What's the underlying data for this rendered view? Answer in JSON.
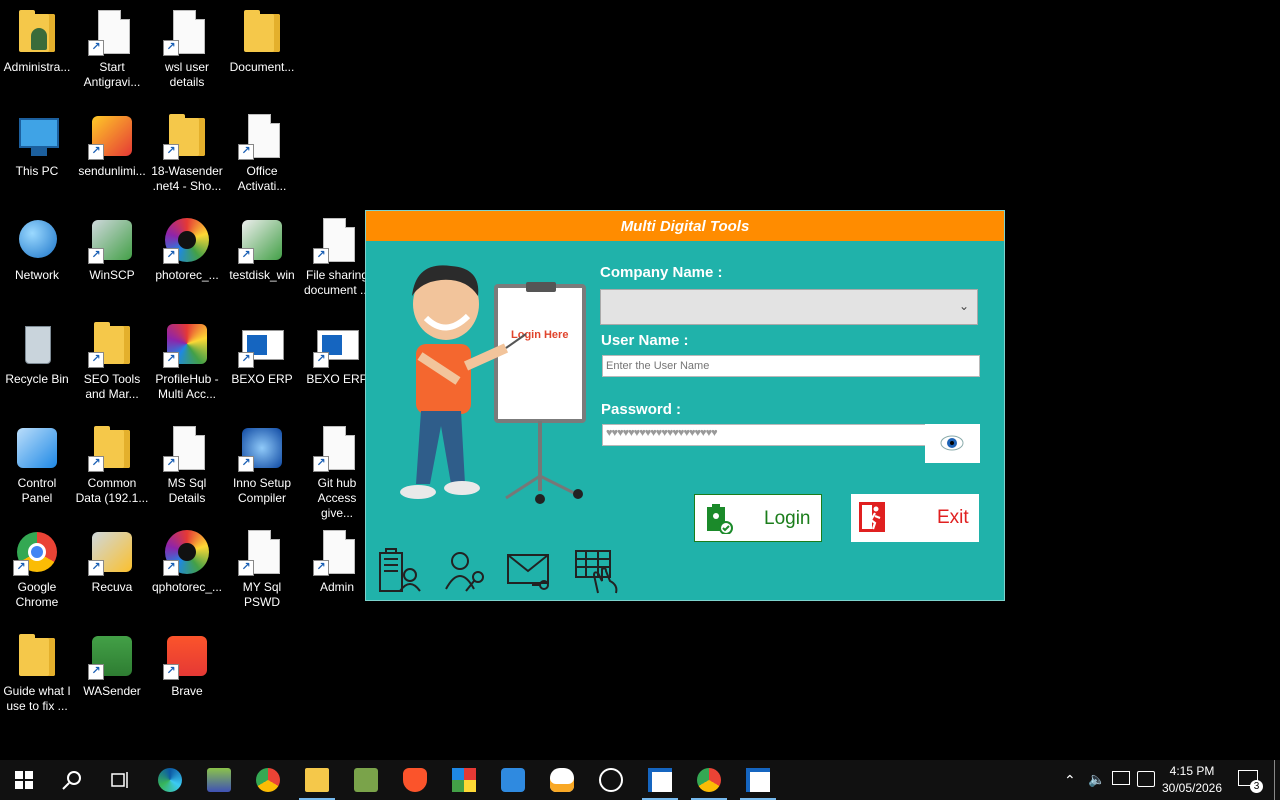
{
  "desktop": {
    "icons": [
      {
        "label": "Administra...",
        "kind": "folder-person"
      },
      {
        "label": "Start\nAntigravi...",
        "kind": "doc"
      },
      {
        "label": "wsl user\ndetails",
        "kind": "doc"
      },
      {
        "label": "Document...",
        "kind": "folder"
      },
      {
        "label": "This PC",
        "kind": "monitor"
      },
      {
        "label": "sendunlimi...",
        "kind": "app"
      },
      {
        "label": "18-Wasender\n.net4 - Sho...",
        "kind": "folder"
      },
      {
        "label": "Office\nActivati...",
        "kind": "doc"
      },
      {
        "label": "Network",
        "kind": "globe"
      },
      {
        "label": "WinSCP",
        "kind": "app"
      },
      {
        "label": "photorec_...",
        "kind": "lens"
      },
      {
        "label": "testdisk_win",
        "kind": "app"
      },
      {
        "label": "File sharing\ndocument ...",
        "kind": "doc"
      },
      {
        "label": "Recycle Bin",
        "kind": "bin"
      },
      {
        "label": "SEO Tools\nand Mar...",
        "kind": "folder"
      },
      {
        "label": "ProfileHub -\nMulti Acc...",
        "kind": "app"
      },
      {
        "label": "BEXO ERP",
        "kind": "window"
      },
      {
        "label": "BEXO ERP",
        "kind": "window"
      },
      {
        "label": "Control\nPanel",
        "kind": "app"
      },
      {
        "label": "Common\nData (192.1...",
        "kind": "folder"
      },
      {
        "label": "MS Sql\nDetails",
        "kind": "doc"
      },
      {
        "label": "Inno Setup\nCompiler",
        "kind": "app"
      },
      {
        "label": "Git hub\nAccess give...",
        "kind": "doc"
      },
      {
        "label": "Google\nChrome",
        "kind": "chrome"
      },
      {
        "label": "Recuva",
        "kind": "app"
      },
      {
        "label": "qphotorec_...",
        "kind": "lens"
      },
      {
        "label": "MY Sql\nPSWD",
        "kind": "doc"
      },
      {
        "label": "Admin",
        "kind": "doc"
      },
      {
        "label": "Guide what I\nuse to fix ...",
        "kind": "folder"
      },
      {
        "label": "WASender",
        "kind": "app"
      },
      {
        "label": "Brave",
        "kind": "app"
      }
    ]
  },
  "dialog": {
    "title": "Multi Digital Tools",
    "board_text": "Login Here",
    "company_label": "Company Name :",
    "company_value": "",
    "user_label": "User Name :",
    "user_placeholder": "Enter the User Name",
    "password_label": "Password :",
    "password_mask": "♥♥♥♥♥♥♥♥♥♥♥♥♥♥♥♥♥♥♥♥",
    "login_label": "Login",
    "exit_label": "Exit",
    "colors": {
      "title_bar": "#ff8c00",
      "body": "#20b2aa",
      "login_text": "#1b7d1b",
      "exit_text": "#e02020"
    }
  },
  "taskbar": {
    "time": "4:15 PM",
    "date": "30/05/2026",
    "notification_count": "3",
    "items": [
      "start-icon",
      "search-icon",
      "task-view-icon",
      "edge-icon",
      "app-icon",
      "chrome-icon",
      "file-explorer-icon",
      "winscp-icon",
      "brave-icon",
      "grid-app-icon",
      "vscode-like-icon",
      "linux-icon",
      "qq-icon",
      "window-app-icon",
      "chrome-icon",
      "window-app-icon"
    ]
  }
}
